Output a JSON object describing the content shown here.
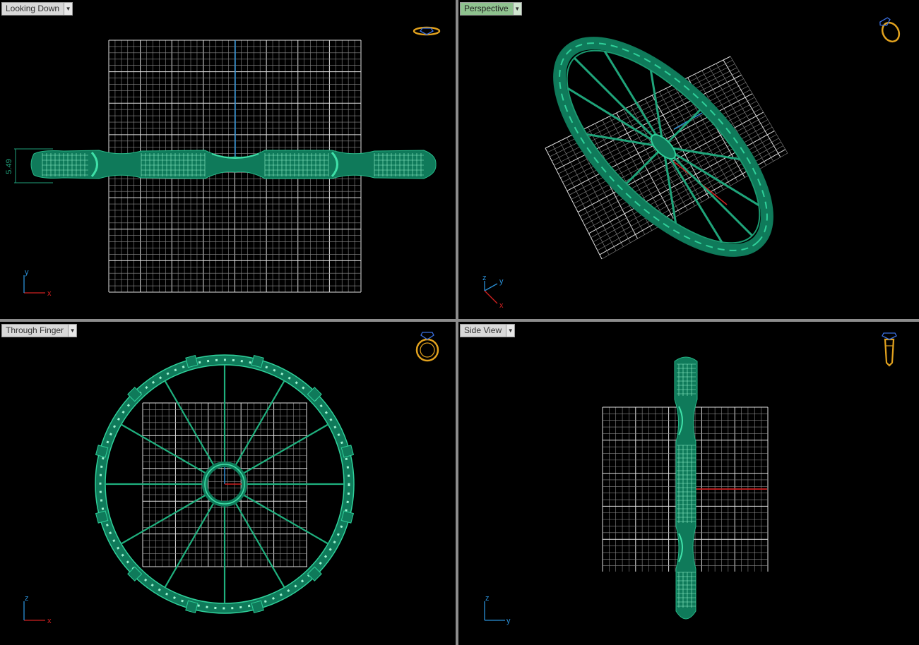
{
  "viewports": {
    "top_left": {
      "title": "Looking Down",
      "active": false,
      "dimension": "5.49",
      "axis": {
        "horizontal": "x",
        "vertical": "y"
      },
      "view_icon": "ring-top-icon"
    },
    "top_right": {
      "title": "Perspective",
      "active": true,
      "axis": {
        "a": "z",
        "b": "y",
        "c": "x"
      },
      "view_icon": "ring-perspective-icon"
    },
    "bottom_left": {
      "title": "Through Finger",
      "active": false,
      "axis": {
        "horizontal": "x",
        "vertical": "z"
      },
      "view_icon": "ring-front-icon"
    },
    "bottom_right": {
      "title": "Side View",
      "active": false,
      "axis": {
        "horizontal": "y",
        "vertical": "z"
      },
      "view_icon": "ring-side-icon"
    }
  },
  "colors": {
    "model": "#0f7a5a",
    "model_highlight": "#2fd09a",
    "grid": "#d0d0d0",
    "axis_x": "#d02020",
    "axis_y": "#2a8fd6",
    "icon_ring": "#e2a21e",
    "icon_gem": "#3a6fe0"
  }
}
